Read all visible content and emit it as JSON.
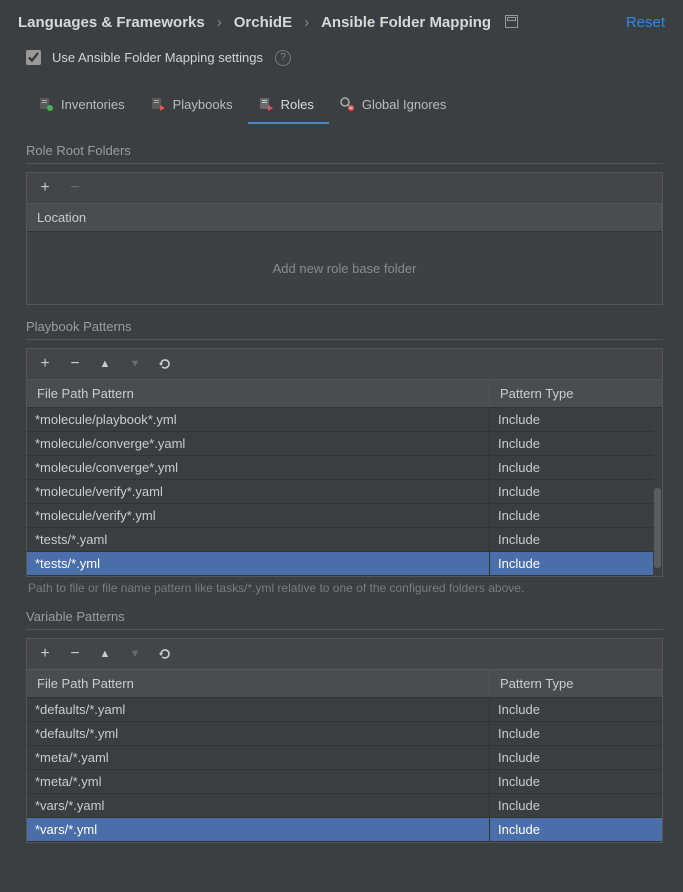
{
  "breadcrumb": {
    "items": [
      "Languages & Frameworks",
      "OrchidE",
      "Ansible Folder Mapping"
    ],
    "reset_label": "Reset"
  },
  "settings": {
    "use_mapping_label": "Use Ansible Folder Mapping settings",
    "use_mapping_checked": true
  },
  "tabs": {
    "items": [
      {
        "label": "Inventories"
      },
      {
        "label": "Playbooks"
      },
      {
        "label": "Roles"
      },
      {
        "label": "Global Ignores"
      }
    ],
    "active": 2
  },
  "role_root": {
    "title": "Role Root Folders",
    "column": "Location",
    "empty_text": "Add new role base folder"
  },
  "playbook": {
    "title": "Playbook Patterns",
    "col_pattern": "File Path Pattern",
    "col_type": "Pattern Type",
    "rows": [
      {
        "path": "*molecule/playbook*.yml",
        "type": "Include"
      },
      {
        "path": "*molecule/converge*.yaml",
        "type": "Include"
      },
      {
        "path": "*molecule/converge*.yml",
        "type": "Include"
      },
      {
        "path": "*molecule/verify*.yaml",
        "type": "Include"
      },
      {
        "path": "*molecule/verify*.yml",
        "type": "Include"
      },
      {
        "path": "*tests/*.yaml",
        "type": "Include"
      },
      {
        "path": "*tests/*.yml",
        "type": "Include"
      }
    ],
    "selected": 6,
    "hint": "Path to file or file name pattern like tasks/*.yml relative to one of the configured folders above."
  },
  "variable": {
    "title": "Variable Patterns",
    "col_pattern": "File Path Pattern",
    "col_type": "Pattern Type",
    "rows": [
      {
        "path": "*defaults/*.yaml",
        "type": "Include"
      },
      {
        "path": "*defaults/*.yml",
        "type": "Include"
      },
      {
        "path": "*meta/*.yaml",
        "type": "Include"
      },
      {
        "path": "*meta/*.yml",
        "type": "Include"
      },
      {
        "path": "*vars/*.yaml",
        "type": "Include"
      },
      {
        "path": "*vars/*.yml",
        "type": "Include"
      }
    ],
    "selected": 5
  },
  "icons": {
    "add": "+",
    "remove": "−",
    "up": "▲",
    "down": "▼",
    "revert": "↺"
  }
}
